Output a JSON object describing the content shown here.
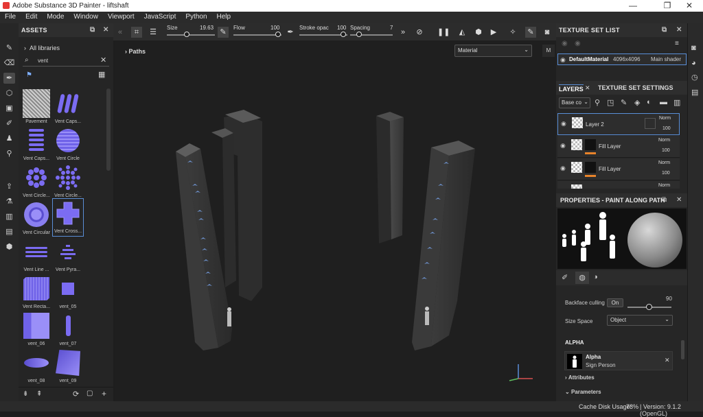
{
  "window": {
    "title": "Adobe Substance 3D Painter - liftshaft",
    "minimize": "—",
    "maximize": "❐",
    "close": "✕"
  },
  "menu": [
    "File",
    "Edit",
    "Mode",
    "Window",
    "Viewport",
    "JavaScript",
    "Python",
    "Help"
  ],
  "assets": {
    "title": "ASSETS",
    "library": "All libraries",
    "search_value": "vent",
    "items": [
      {
        "label": "Pavement"
      },
      {
        "label": "Vent Caps..."
      },
      {
        "label": "Vent Caps..."
      },
      {
        "label": "Vent Circle"
      },
      {
        "label": "Vent Circle..."
      },
      {
        "label": "Vent Circle..."
      },
      {
        "label": "Vent Circular"
      },
      {
        "label": "Vent Cross..."
      },
      {
        "label": "Vent Line ..."
      },
      {
        "label": "Vent Pyra..."
      },
      {
        "label": "Vent Recta..."
      },
      {
        "label": "vent_05"
      },
      {
        "label": "vent_06"
      },
      {
        "label": "vent_07"
      },
      {
        "label": "vent_08"
      },
      {
        "label": "vent_09"
      }
    ]
  },
  "toolbar": {
    "size_label": "Size",
    "size_value": "19.63",
    "flow_label": "Flow",
    "flow_value": "100",
    "stroke_label": "Stroke opac",
    "stroke_value": "100",
    "spacing_label": "Spacing",
    "spacing_value": "7"
  },
  "viewport": {
    "paths_label": "Paths",
    "mode_select": "Material",
    "mini_tab": "M"
  },
  "texture_set_list": {
    "title": "TEXTURE SET LIST",
    "name": "DefaultMaterial",
    "resolution": "4096x4096",
    "shader": "Main shader"
  },
  "layers": {
    "tab_layers": "LAYERS",
    "tab_settings": "TEXTURE SET SETTINGS",
    "channel": "Base co",
    "items": [
      {
        "name": "Layer 2",
        "blend": "Norm",
        "opacity": "100"
      },
      {
        "name": "Fill Layer",
        "blend": "Norm",
        "opacity": "100"
      },
      {
        "name": "Fill Layer",
        "blend": "Norm",
        "opacity": "100"
      },
      {
        "name": "",
        "blend": "Norm",
        "opacity": ""
      }
    ]
  },
  "properties": {
    "title": "PROPERTIES - PAINT ALONG PATH",
    "backface_label": "Backface culling",
    "backface_value": "On",
    "backface_number": "90",
    "size_space_label": "Size Space",
    "size_space_value": "Object",
    "alpha_section": "ALPHA",
    "alpha_name": "Alpha",
    "alpha_sub": "Sign Person",
    "attributes": "Attributes",
    "parameters": "Parameters"
  },
  "status": {
    "cache": "Cache Disk Usage:",
    "cache_value": "78%",
    "version": "| Version: 9.1.2 (OpenGL)"
  },
  "colors": {
    "accent": "#5a8fd8",
    "vent": "#7b6cf2",
    "orange": "#e8832a"
  }
}
